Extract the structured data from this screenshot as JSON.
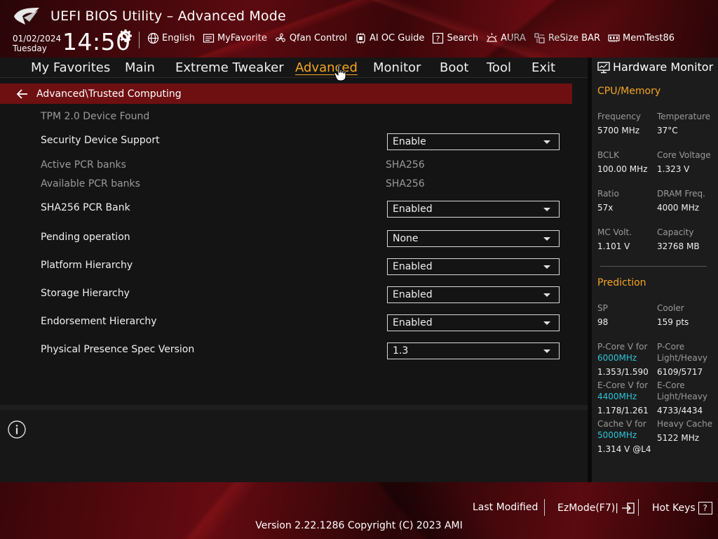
{
  "header": {
    "title": "UEFI BIOS Utility – Advanced Mode",
    "date": "01/02/2024",
    "day": "Tuesday",
    "time": "14:50",
    "toolbar": [
      {
        "label": "English",
        "icon": "globe-icon"
      },
      {
        "label": "MyFavorite",
        "icon": "favorite-icon"
      },
      {
        "label": "Qfan Control",
        "icon": "fan-icon"
      },
      {
        "label": "AI OC Guide",
        "icon": "chip-icon"
      },
      {
        "label": "Search",
        "icon": "question-box-icon"
      },
      {
        "label": "AURA",
        "icon": "aura-light-icon"
      },
      {
        "label": "ReSize BAR",
        "icon": "resize-bar-icon"
      },
      {
        "label": "MemTest86",
        "icon": "memory-icon"
      }
    ]
  },
  "menu": {
    "items": [
      "My Favorites",
      "Main",
      "Extreme Tweaker",
      "Advanced",
      "Monitor",
      "Boot",
      "Tool",
      "Exit"
    ],
    "active": "Advanced"
  },
  "breadcrumb": "Advanced\\Trusted Computing",
  "settings": {
    "tpm_found": "TPM 2.0 Device Found",
    "rows": [
      {
        "label": "Security Device Support",
        "value": "Enable"
      },
      {
        "label": "Active PCR banks",
        "value": "SHA256"
      },
      {
        "label": "Available PCR banks",
        "value": "SHA256"
      },
      {
        "label": "SHA256 PCR Bank",
        "value": "Enabled"
      },
      {
        "label": "Pending operation",
        "value": "None"
      },
      {
        "label": "Platform Hierarchy",
        "value": "Enabled"
      },
      {
        "label": "Storage Hierarchy",
        "value": "Enabled"
      },
      {
        "label": "Endorsement Hierarchy",
        "value": "Enabled"
      },
      {
        "label": "Physical Presence Spec Version",
        "value": "1.3"
      }
    ]
  },
  "hw": {
    "title": "Hardware Monitor",
    "cpu_section": "CPU/Memory",
    "cpu": [
      {
        "k": "Frequency",
        "v": "5700 MHz"
      },
      {
        "k": "Temperature",
        "v": "37°C"
      },
      {
        "k": "BCLK",
        "v": "100.00 MHz"
      },
      {
        "k": "Core Voltage",
        "v": "1.323 V"
      },
      {
        "k": "Ratio",
        "v": "57x"
      },
      {
        "k": "DRAM Freq.",
        "v": "4000 MHz"
      },
      {
        "k": "MC Volt.",
        "v": "1.101 V"
      },
      {
        "k": "Capacity",
        "v": "32768 MB"
      }
    ],
    "pred_section": "Prediction",
    "pred": {
      "sp_k": "SP",
      "sp_v": "98",
      "cooler_k": "Cooler",
      "cooler_v": "159 pts",
      "pcore_k": "P-Core V for",
      "pcore_freq": "6000MHz",
      "pcore_v": "1.353/1.590",
      "pcore_lh_k1": "P-Core",
      "pcore_lh_k2": "Light/Heavy",
      "pcore_lh_v": "6109/5717",
      "ecore_k": "E-Core V for",
      "ecore_freq": "4400MHz",
      "ecore_v": "1.178/1.261",
      "ecore_lh_k1": "E-Core",
      "ecore_lh_k2": "Light/Heavy",
      "ecore_lh_v": "4733/4434",
      "cache_k": "Cache V for",
      "cache_freq": "5000MHz",
      "cache_v": "1.314 V @L4",
      "heavy_cache_k": "Heavy Cache",
      "heavy_cache_v": "5122 MHz"
    }
  },
  "footer": {
    "last_modified": "Last Modified",
    "ezmode": "EzMode(F7)|",
    "hotkeys": "Hot Keys",
    "hotkeys_key": "?",
    "version": "Version 2.22.1286 Copyright (C) 2023 AMI"
  },
  "colors": {
    "accent": "#f5a623",
    "highlight_cyan": "#2ec4d6",
    "breadcrumb_bg": "#6e0f12"
  }
}
